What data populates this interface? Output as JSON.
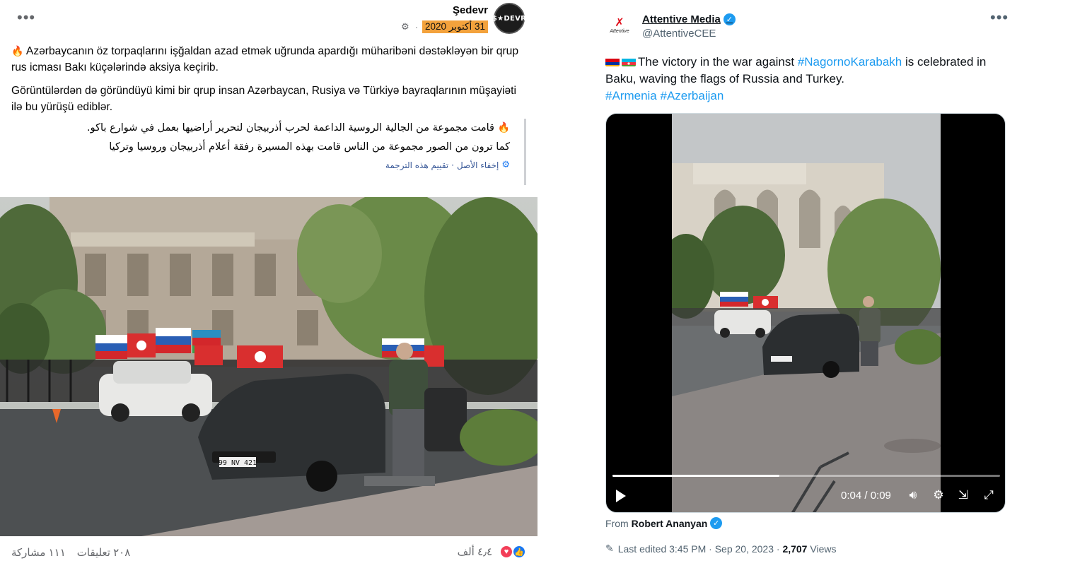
{
  "facebook": {
    "author": "Şedevr",
    "avatar_text": "$★DEVR",
    "date": "31 أكتوبر 2020",
    "paragraph1": "Azərbaycanın öz torpaqlarını işğaldan azad etmək uğrunda apardığı müharibəni dəstəkləyən bir qrup rus icması Bakı küçələrində aksiya keçirib.",
    "paragraph2": "Görüntülərdən də göründüyü kimi bir qrup insan Azərbaycan, Rusiya və Türkiyə bayraqlarının müşayiəti ilə bu yürüşü ediblər.",
    "translation_line1": "قامت مجموعة من الجالية الروسية الداعمة لحرب أذربيجان لتحرير أراضيها بعمل في شوارع باكو.",
    "translation_line2": "كما ترون من الصور مجموعة من الناس قامت بهذه المسيرة رفقة أعلام أذربيجان وروسيا وتركيا",
    "hide_original": "إخفاء الأصل",
    "rate_translation": "تقييم هذه الترجمة",
    "reactions_count": "٤٫٤ ألف",
    "comments": "٢٠٨ تعليقات",
    "shares": "١١١ مشاركة",
    "license_plate": "99 NV 421"
  },
  "twitter": {
    "display_name": "Attentive Media",
    "handle": "@AttentiveCEE",
    "logo_text": "Attentive",
    "text_main": "The victory in the war against ",
    "tag1": "#NagornoKarabakh",
    "text_mid": " is celebrated in Baku, waving the flags of Russia and Turkey.",
    "tag2": "#Armenia",
    "tag3": "#Azerbaijan",
    "video_time": "0:04 / 0:09",
    "video_progress": 0.43,
    "from_label": "From",
    "from_name": "Robert Ananyan",
    "last_edited": "Last edited 3:45 PM · Sep 20, 2023 · ",
    "views_count": "2,707",
    "views_label": " Views"
  },
  "colors": {
    "twitter_blue": "#1d9bf0",
    "fb_blue": "#1877f2",
    "date_highlight": "#f3a23c"
  }
}
